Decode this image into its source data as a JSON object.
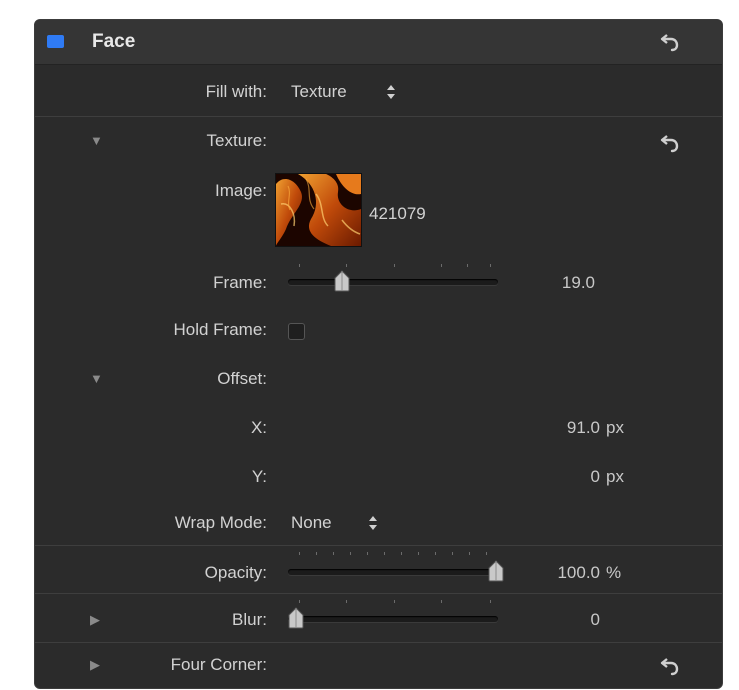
{
  "header": {
    "title": "Face",
    "swatch_color": "#2f7bf5",
    "reset_icon": "reset-arrow-icon"
  },
  "fill_with": {
    "label": "Fill with:",
    "value": "Texture"
  },
  "texture": {
    "label": "Texture:",
    "expanded": true
  },
  "image": {
    "label": "Image:",
    "name": "421079"
  },
  "frame": {
    "label": "Frame:",
    "value": "19.0",
    "slider_level": 0.23
  },
  "hold_frame": {
    "label": "Hold Frame:",
    "checked": false
  },
  "offset": {
    "label": "Offset:",
    "expanded": true,
    "x": {
      "label": "X:",
      "value": "91.0",
      "unit": "px"
    },
    "y": {
      "label": "Y:",
      "value": "0",
      "unit": "px"
    }
  },
  "wrap_mode": {
    "label": "Wrap Mode:",
    "value": "None"
  },
  "opacity": {
    "label": "Opacity:",
    "value": "100.0",
    "unit": "%",
    "slider_level": 1.0
  },
  "blur": {
    "label": "Blur:",
    "value": "0",
    "expanded": false,
    "slider_level": 0.0
  },
  "four_corner": {
    "label": "Four Corner:",
    "expanded": false
  }
}
